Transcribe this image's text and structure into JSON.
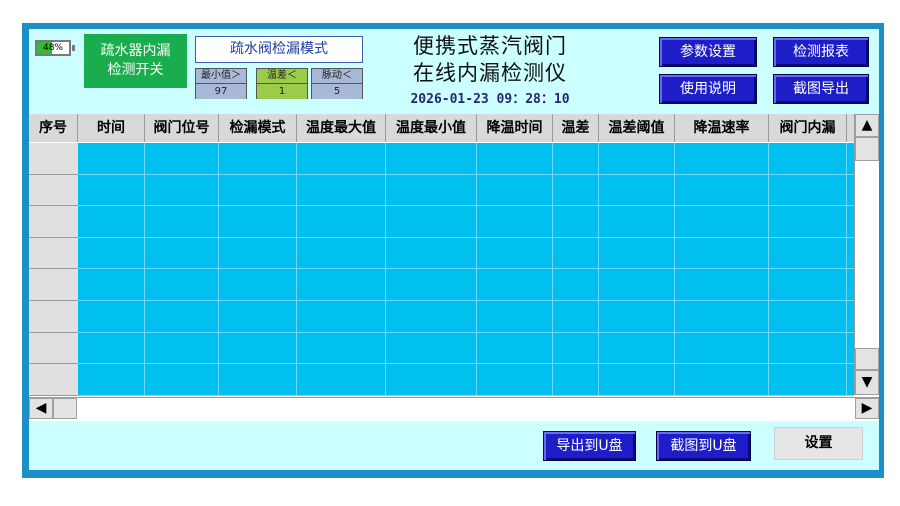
{
  "battery": {
    "label": "48%",
    "level": 0.48
  },
  "leak_switch": {
    "line1": "疏水器内漏",
    "line2": "检测开关"
  },
  "mode": {
    "label": "疏水阀检漏模式"
  },
  "params": [
    {
      "label": "最小值＞",
      "value": "97",
      "color": "#a8b8d8"
    },
    {
      "label": "温差＜",
      "value": "1",
      "color": "#9acc4a"
    },
    {
      "label": "脉动＜",
      "value": "5",
      "color": "#a8b8d8"
    }
  ],
  "title": {
    "line1": "便携式蒸汽阀门",
    "line2": "在线内漏检测仪"
  },
  "datetime": "2026-01-23 09：28：10",
  "top_buttons": {
    "param_settings": "参数设置",
    "detection_report": "检测报表",
    "user_manual": "使用说明",
    "screenshot_export": "截图导出"
  },
  "table": {
    "columns": [
      "序号",
      "时间",
      "阀门位号",
      "检漏模式",
      "温度最大值",
      "温度最小值",
      "降温时间",
      "温差",
      "温差阈值",
      "降温速率",
      "阀门内漏"
    ],
    "row_count": 8
  },
  "scroll": {
    "up": "▲",
    "down": "▼",
    "left": "◀",
    "right": "▶"
  },
  "bottom_buttons": {
    "export_usb": "导出到U盘",
    "screenshot_usb": "截图到U盘",
    "settings": "设置"
  }
}
